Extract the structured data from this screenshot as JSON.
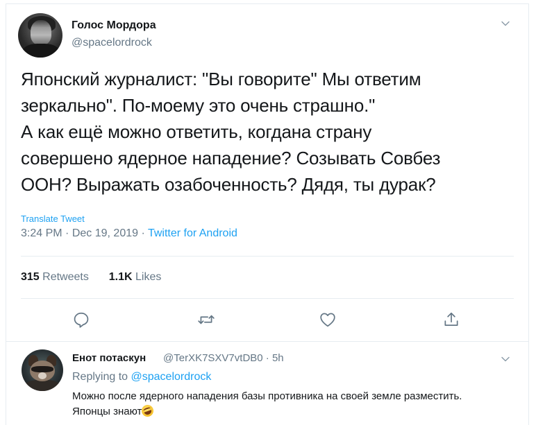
{
  "tweet": {
    "author_name": "Голос Мордора",
    "author_handle": "@spacelordrock",
    "text": "Японский журналист: \"Вы говорите\" Мы ответим\nзеркально\". По-моему это очень страшно.\"\nА как ещё можно ответить, когдана страну\nсовершено ядерное нападение? Созывать Совбез\nООН? Выражать озабоченность? Дядя, ты дурак?",
    "translate_label": "Translate Tweet",
    "time": "3:24 PM",
    "date": "Dec 19, 2019",
    "separator": "·",
    "source": "Twitter for Android",
    "retweets_count": "315",
    "retweets_label": "Retweets",
    "likes_count": "1.1K",
    "likes_label": "Likes"
  },
  "actions": {
    "reply_icon": "reply-icon",
    "retweet_icon": "retweet-icon",
    "like_icon": "like-icon",
    "share_icon": "share-icon"
  },
  "reply": {
    "author_name": "Енот потаскун",
    "author_handle": "@TerXK7SXV7vtDB0",
    "separator": "·",
    "time_ago": "5h",
    "replying_to_label": "Replying to",
    "replying_to_handle": "@spacelordrock",
    "text": "Можно после ядерного нападения базы противника на своей земле разместить. Японцы знают",
    "emoji": "rolling-on-floor-laughing"
  },
  "colors": {
    "text": "#14171a",
    "secondary": "#657786",
    "link": "#1da1f2",
    "divider": "#e6ecf0"
  }
}
